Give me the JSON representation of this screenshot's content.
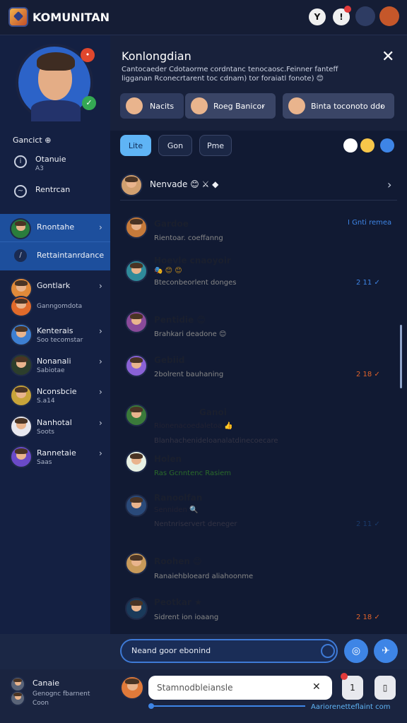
{
  "app": {
    "title": "KOMUNITAN"
  },
  "topbar": {
    "badge1": "",
    "icon1": "Y",
    "icon2": "!"
  },
  "profile": {
    "status_badge": "•",
    "online_badge": "✓"
  },
  "sidebar": {
    "section_label": "Gancict ⊕",
    "links": [
      {
        "title": "Otanuie",
        "sub": "A3"
      },
      {
        "title": "Rentrcan",
        "sub": ""
      }
    ],
    "selected": {
      "title": "Rnontahe",
      "sub": "Rettaintanrdance"
    },
    "group": {
      "title": "Gontlark",
      "sub": "Ganngomdota"
    },
    "contacts": [
      {
        "title": "Kenterais",
        "sub": "Soo tecomstar"
      },
      {
        "title": "Nonanali",
        "sub": "Sabiotae"
      },
      {
        "title": "Nconsbcie",
        "sub": "S.a14"
      },
      {
        "title": "Nanhotal",
        "sub": "Soots"
      },
      {
        "title": "Rannetaie",
        "sub": "Saas"
      }
    ],
    "bottom": {
      "title": "Canaie",
      "line2": "Genognc fbarnent",
      "line3": "Coon"
    }
  },
  "header": {
    "title": "Konlongdian",
    "desc": "Cantocaeder Cdotaorme cordntanc tenocaosc.Feinner fanteff ligganan Rconecrtarent toc cdnam) tor foraiatl fonote) 😊",
    "close": "✕",
    "pills": [
      {
        "label": "Nacits"
      },
      {
        "label": "Roeg Banicor"
      },
      {
        "label": "Binta toconoto ddo"
      }
    ]
  },
  "filters": {
    "tabs": [
      "Lite",
      "Gon",
      "Pme"
    ]
  },
  "chat_header": {
    "title": "Nenvade 😊 ⚔ ◆"
  },
  "cards": [
    {
      "type": "white",
      "tag": "I Gnti remea",
      "messages": [
        {
          "name": "Gardoe",
          "sub": "Rientoar. coeffanng"
        },
        {
          "name": "Hoevle cnaoyoir",
          "sub": "Bteconbeorlent donges"
        }
      ],
      "emoji_line": "🎭 😊 😊",
      "time": "2 11 ✓"
    },
    {
      "type": "beige",
      "messages": [
        {
          "name": "Pentidie 😊",
          "sub": "Brahkari deadone 😊"
        },
        {
          "name": "Gebiid",
          "sub": "2bolrent bauhaning"
        }
      ],
      "time": "2 18 ✓"
    },
    {
      "type": "blue",
      "messages": [
        {
          "name": "Ganoi",
          "sub": "Rionenacoedaletoa 👍"
        },
        {
          "name": "",
          "sub": "Blanhachenideloanalatdinecoecare"
        },
        {
          "name": "Holen",
          "sub": "Ras Gcnntenc Rasiem"
        },
        {
          "name": "Ranoolfan",
          "sub": "Senniden 🔍"
        }
      ],
      "footer": "Nentnriservert deneger",
      "time": "2 11 ✓"
    },
    {
      "type": "white",
      "messages": [
        {
          "name": "Roohen 😊",
          "sub": "Ranaiehbloeard aliahoonme"
        },
        {
          "name": "Peotkar ★",
          "sub": "Sidrent ion ioaang"
        }
      ],
      "time": "2 18 ✓"
    }
  ],
  "composer": {
    "search_text": "Neand goor ebonind",
    "input_placeholder": "Stamnodbleiansle",
    "progress_label": "Aariorenetteflaint com",
    "progress_value": 0.95
  },
  "colors": {
    "accent": "#3e85e6",
    "selected": "#1d4f9d",
    "beige": "#f3ead9",
    "bluecard": "#8ec5f2"
  }
}
